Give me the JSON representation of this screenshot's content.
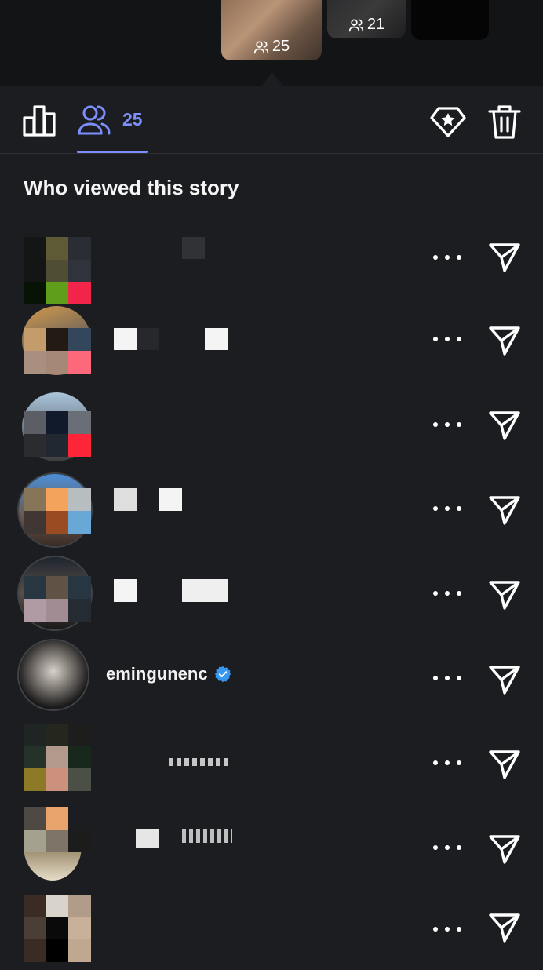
{
  "story_strip": {
    "current_viewer_count": "25",
    "next_viewer_count": "21"
  },
  "tabs": {
    "viewers_count": "25"
  },
  "section": {
    "title": "Who viewed this story"
  },
  "viewers": [
    {
      "username": "",
      "verified": false
    },
    {
      "username": "",
      "verified": false
    },
    {
      "username": "",
      "verified": false
    },
    {
      "username": "",
      "verified": false
    },
    {
      "username": "",
      "verified": false
    },
    {
      "username": "emingunenc",
      "verified": true
    },
    {
      "username": "",
      "verified": false
    },
    {
      "username": "",
      "verified": false
    },
    {
      "username": "",
      "verified": false
    }
  ],
  "icons": {
    "insights": "bar-chart-icon",
    "viewers": "people-icon",
    "highlight": "diamond-star-icon",
    "delete": "trash-icon",
    "more": "more-horizontal-icon",
    "send": "send-icon",
    "verified": "verified-badge-icon"
  },
  "colors": {
    "accent": "#7d8fff",
    "background": "#1b1d20",
    "verified": "#3897f0"
  }
}
